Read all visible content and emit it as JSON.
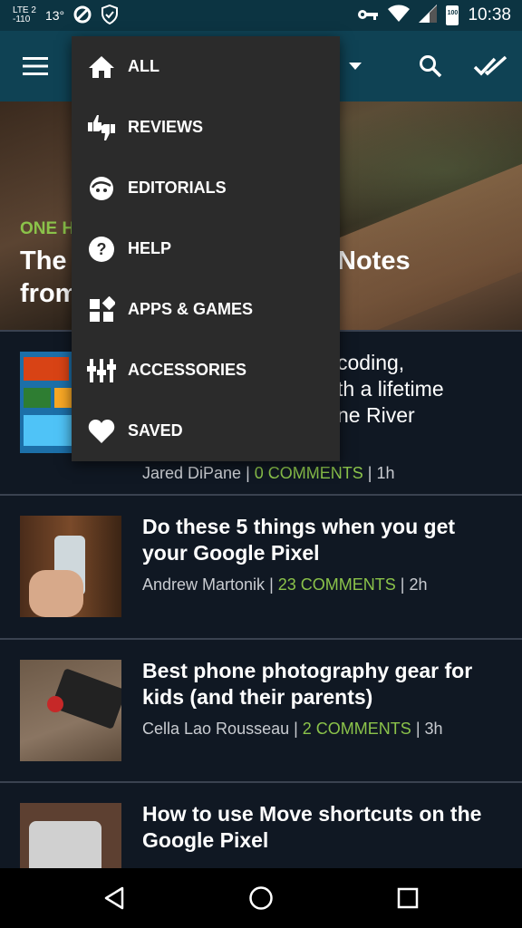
{
  "status_bar": {
    "network": "LTE",
    "lte_top": "LTE 2",
    "lte_bottom": "-110",
    "temperature": "13°",
    "battery": "100",
    "time": "10:38"
  },
  "toolbar": {
    "menu_icon": "hamburger-icon",
    "search_icon": "search-icon",
    "mark_read_icon": "done-all-icon",
    "dropdown_icon": "arrow-drop-down-icon"
  },
  "menu": {
    "items": [
      {
        "label": "ALL",
        "icon": "home-icon"
      },
      {
        "label": "REVIEWS",
        "icon": "thumbs-icon"
      },
      {
        "label": "EDITORIALS",
        "icon": "face-icon"
      },
      {
        "label": "HELP",
        "icon": "help-icon"
      },
      {
        "label": "APPS & GAMES",
        "icon": "apps-icon"
      },
      {
        "label": "ACCESSORIES",
        "icon": "accessories-icon"
      },
      {
        "label": "SAVED",
        "icon": "heart-icon"
      }
    ]
  },
  "hero": {
    "kicker_visible": "ONE H",
    "title_line1_left": "The",
    "title_line2_left": "from",
    "title_line1_right": "Notes"
  },
  "articles": [
    {
      "partial_lines": [
        "coding,",
        "th a lifetime",
        "ne River"
      ],
      "author": "Jared DiPane",
      "sep1": " | ",
      "comments": "0 COMMENTS",
      "sep2": " | ",
      "age": "1h"
    },
    {
      "title": "Do these 5 things when you get your Google Pixel",
      "author": "Andrew Martonik",
      "sep1": " | ",
      "comments": "23 COMMENTS",
      "sep2": " | ",
      "age": "2h"
    },
    {
      "title": "Best phone photography gear for kids (and their parents)",
      "author": "Cella Lao Rousseau",
      "sep1": " | ",
      "comments": "2 COMMENTS",
      "sep2": " | ",
      "age": "3h"
    },
    {
      "title": "How to use Move shortcuts on the Google Pixel"
    }
  ],
  "nav": {
    "back_icon": "back-icon",
    "home_icon": "home-circle-icon",
    "recents_icon": "recents-icon"
  },
  "colors": {
    "toolbar": "#0f4254",
    "status_bar": "#0c3442",
    "accent": "#8bc34a",
    "menu_bg": "#2b2b2b",
    "background": "#101823"
  }
}
